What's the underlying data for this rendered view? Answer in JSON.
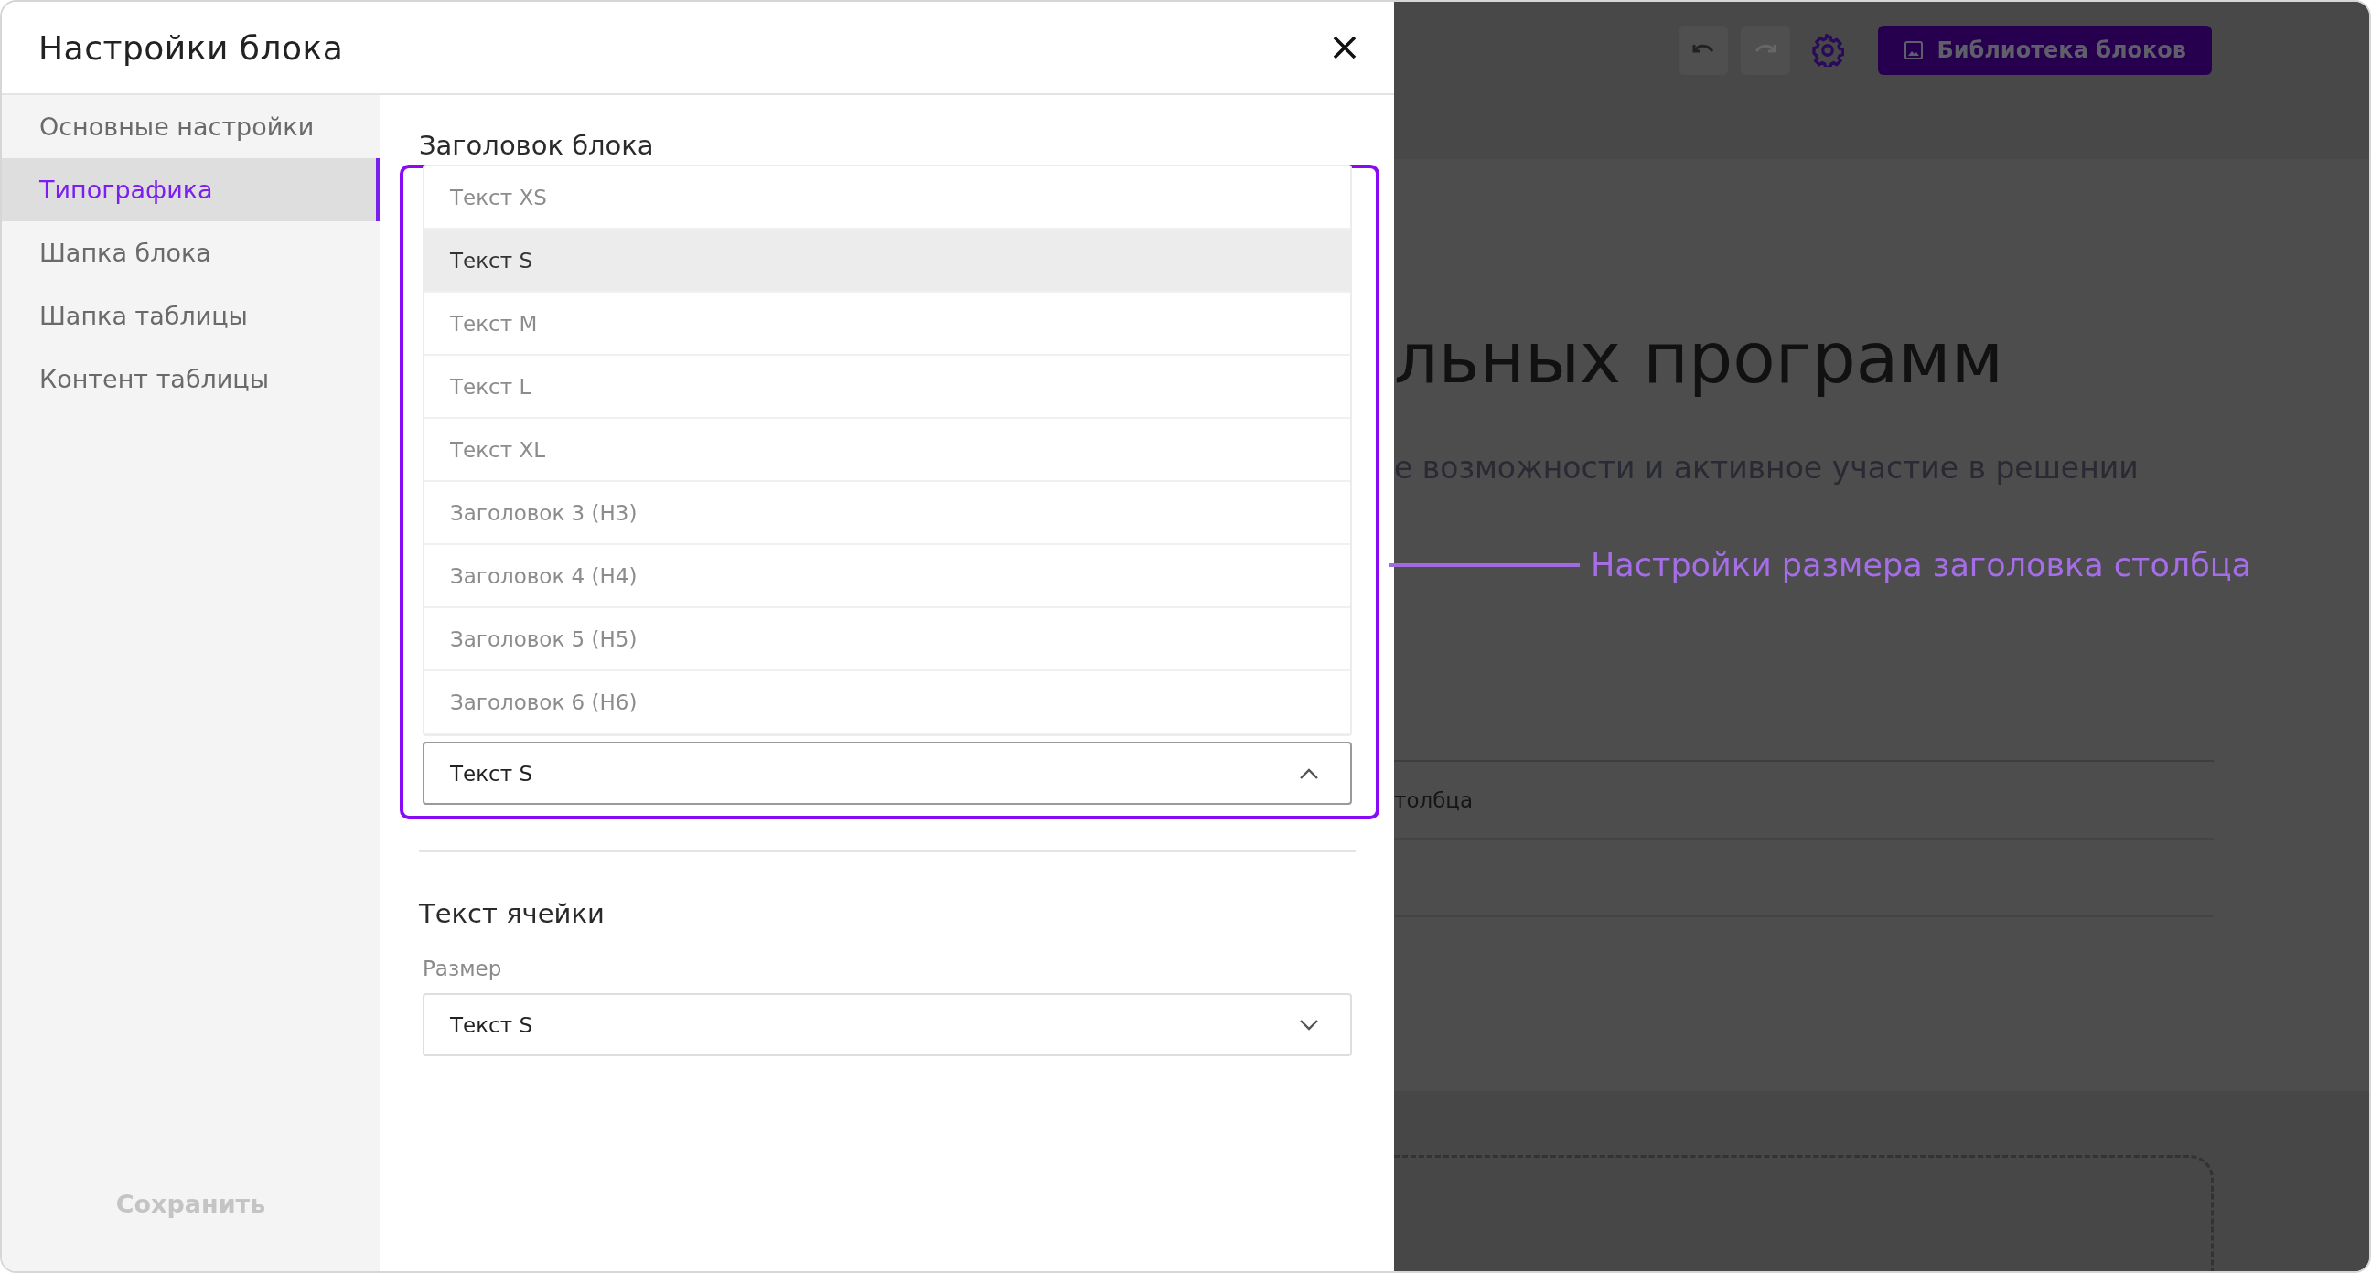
{
  "dialog": {
    "title": "Настройки блока"
  },
  "sidebar": {
    "items": [
      {
        "label": "Основные настройки",
        "selected": false
      },
      {
        "label": "Типографика",
        "selected": true
      },
      {
        "label": "Шапка блока",
        "selected": false
      },
      {
        "label": "Шапка таблицы",
        "selected": false
      },
      {
        "label": "Контент таблицы",
        "selected": false
      }
    ],
    "save_button": {
      "label": "Сохранить",
      "disabled": true
    }
  },
  "sections": [
    {
      "title": "Заголовок блока",
      "highlighted": true,
      "select": {
        "value": "Текст S",
        "expanded": true,
        "options": [
          {
            "label": "Текст XS",
            "selected": false
          },
          {
            "label": "Текст S",
            "selected": true
          },
          {
            "label": "Текст M",
            "selected": false
          },
          {
            "label": "Текст L",
            "selected": false
          },
          {
            "label": "Текст XL",
            "selected": false
          },
          {
            "label": "Заголовок 3 (H3)",
            "selected": false
          },
          {
            "label": "Заголовок 4 (H4)",
            "selected": false
          },
          {
            "label": "Заголовок 5 (H5)",
            "selected": false
          },
          {
            "label": "Заголовок 6 (H6)",
            "selected": false
          }
        ]
      }
    },
    {
      "title": "Текст ячейки",
      "select": {
        "label": "Размер",
        "value": "Текст S",
        "expanded": false
      }
    }
  ],
  "annotation": {
    "text": "Настройки размера заголовка столбца"
  },
  "background": {
    "toolbar": [
      {
        "kind": "undo",
        "disabled": false
      },
      {
        "kind": "redo",
        "disabled": true
      },
      {
        "kind": "settings",
        "disabled": false
      }
    ],
    "library_button": {
      "label": "Библиотека блоков"
    },
    "heading": "льных программ",
    "subtitle": "е возможности и активное участие в решении",
    "table_cells": [
      "толбца"
    ]
  }
}
